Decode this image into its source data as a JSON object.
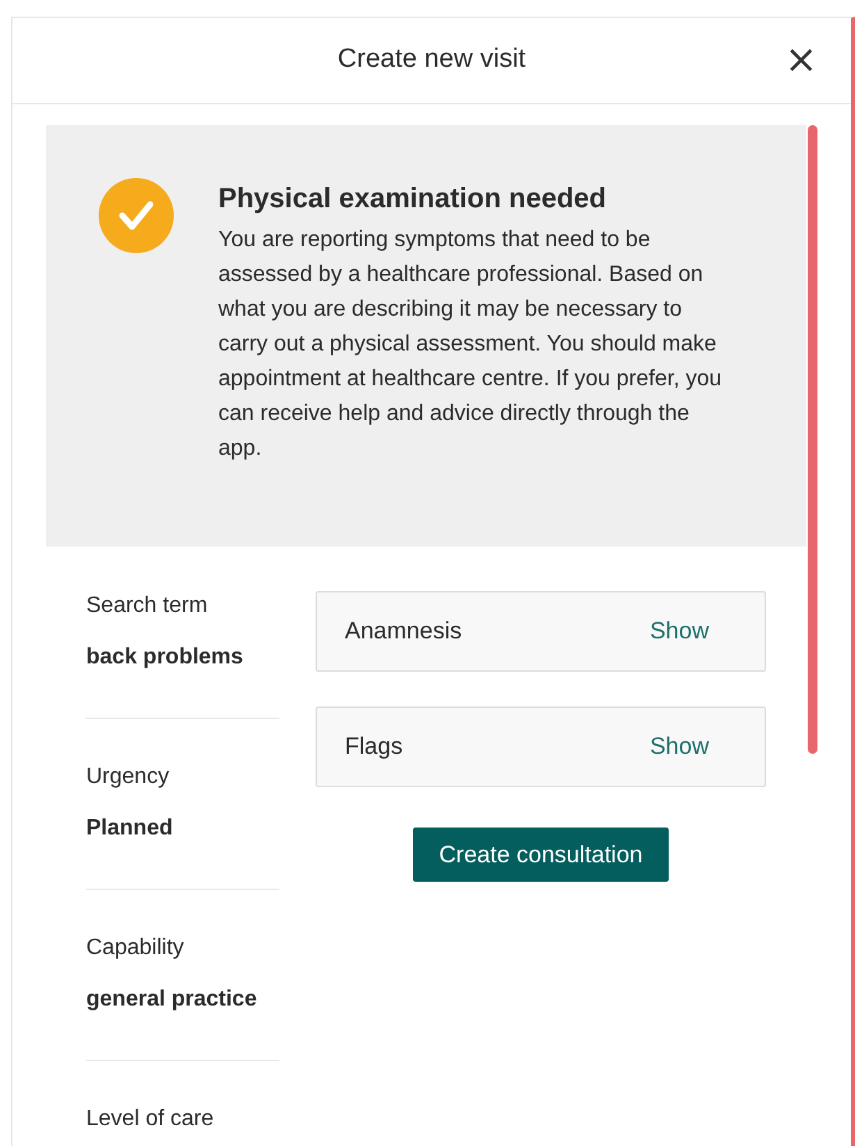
{
  "dialog": {
    "title": "Create new visit",
    "close": "×"
  },
  "notice": {
    "title": "Physical examination needed",
    "text": "You are reporting symptoms that need to be assessed by a healthcare professional. Based on what you are describing it may be necessary to carry out a physical assessment. You should make appointment at healthcare centre. If you prefer, you can receive help and advice directly through the app."
  },
  "details": [
    {
      "label": "Search term",
      "value": "back problems"
    },
    {
      "label": "Urgency",
      "value": "Planned"
    },
    {
      "label": "Capability",
      "value": "general practice"
    },
    {
      "label": "Level of care"
    }
  ],
  "sections": [
    {
      "title": "Anamnesis",
      "action": "Show"
    },
    {
      "title": "Flags",
      "action": "Show"
    }
  ],
  "primary_button": "Create consultation"
}
